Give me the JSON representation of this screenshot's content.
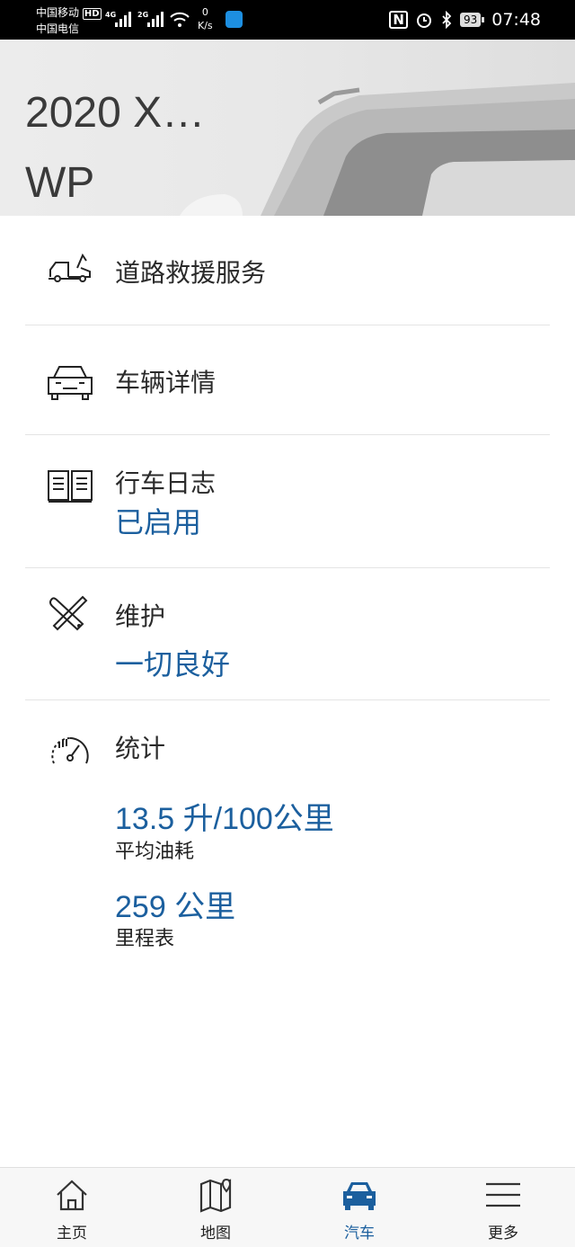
{
  "status_bar": {
    "carrier_1": "中国移动",
    "carrier_1_tag": "HD",
    "carrier_2": "中国电信",
    "net_1": "4G",
    "net_2": "2G",
    "speed_value": "0",
    "speed_unit": "K/s",
    "battery": "93",
    "time": "07:48"
  },
  "hero": {
    "title": "2020 X…",
    "subtitle": "WP"
  },
  "menu": {
    "roadside": {
      "label": "道路救援服务",
      "icon": "tow-truck-icon"
    },
    "vehicle_details": {
      "label": "车辆详情",
      "icon": "car-front-icon"
    },
    "drive_log": {
      "label": "行车日志",
      "value": "已启用",
      "icon": "logbook-icon"
    },
    "maintenance": {
      "label": "维护",
      "value": "一切良好",
      "icon": "wrench-screwdriver-icon"
    },
    "statistics": {
      "label": "统计",
      "icon": "gauge-icon",
      "fuel_value": "13.5 升/100公里",
      "fuel_label": "平均油耗",
      "odometer_value": "259 公里",
      "odometer_label": "里程表"
    }
  },
  "bottom_nav": {
    "active": "car",
    "items": [
      {
        "id": "home",
        "label": "主页",
        "icon": "home-icon"
      },
      {
        "id": "map",
        "label": "地图",
        "icon": "map-icon"
      },
      {
        "id": "car",
        "label": "汽车",
        "icon": "car-icon"
      },
      {
        "id": "more",
        "label": "更多",
        "icon": "menu-icon"
      }
    ]
  },
  "colors": {
    "accent": "#1b5f9e",
    "status_bar": "#000000"
  }
}
